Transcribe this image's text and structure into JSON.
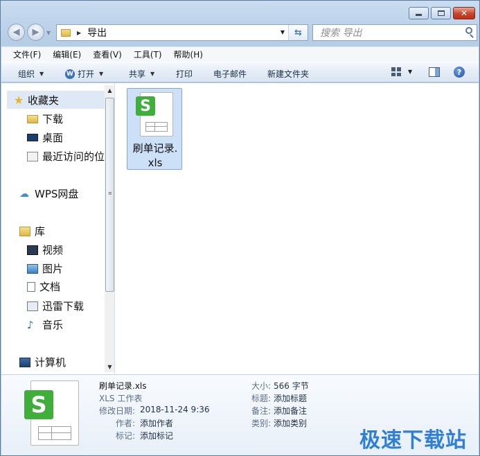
{
  "window": {
    "minimize": "—",
    "maximize": "□",
    "close": "✕"
  },
  "nav": {
    "back_glyph": "◀",
    "forward_glyph": "▶",
    "address_crumb": "导出",
    "search_placeholder": "搜索 导出"
  },
  "menu": [
    "文件(F)",
    "编辑(E)",
    "查看(V)",
    "工具(T)",
    "帮助(H)"
  ],
  "toolbar": {
    "organize": "组织",
    "open": "打开",
    "share": "共享",
    "print": "打印",
    "email": "电子邮件",
    "new_folder": "新建文件夹"
  },
  "sidebar": {
    "favorites": "收藏夹",
    "fav_items": [
      "下载",
      "桌面",
      "最近访问的位"
    ],
    "wps_drive": "WPS网盘",
    "libraries": "库",
    "lib_items": [
      "视频",
      "图片",
      "文档",
      "迅雷下载",
      "音乐"
    ],
    "computer": "计算机"
  },
  "files": [
    {
      "name_line1": "刷单记录.",
      "name_line2": "xls",
      "icon": "wps-spreadsheet-icon"
    }
  ],
  "details": {
    "file_name": "刷单记录.xls",
    "file_type": "XLS 工作表",
    "modified_label": "修改日期:",
    "modified_value": "2018-11-24 9:36",
    "author_label": "作者:",
    "author_value": "添加作者",
    "tags_label": "标记:",
    "tags_value": "添加标记",
    "size_label": "大小:",
    "size_value": "566 字节",
    "title_label": "标题:",
    "title_value": "添加标题",
    "notes_label": "备注:",
    "notes_value": "添加备注",
    "category_label": "类别:",
    "category_value": "添加类别"
  },
  "watermark": "极速下载站",
  "colors": {
    "accent": "#2f7fd6",
    "selection": "#cce0f7",
    "wps_green": "#3fae3a"
  }
}
